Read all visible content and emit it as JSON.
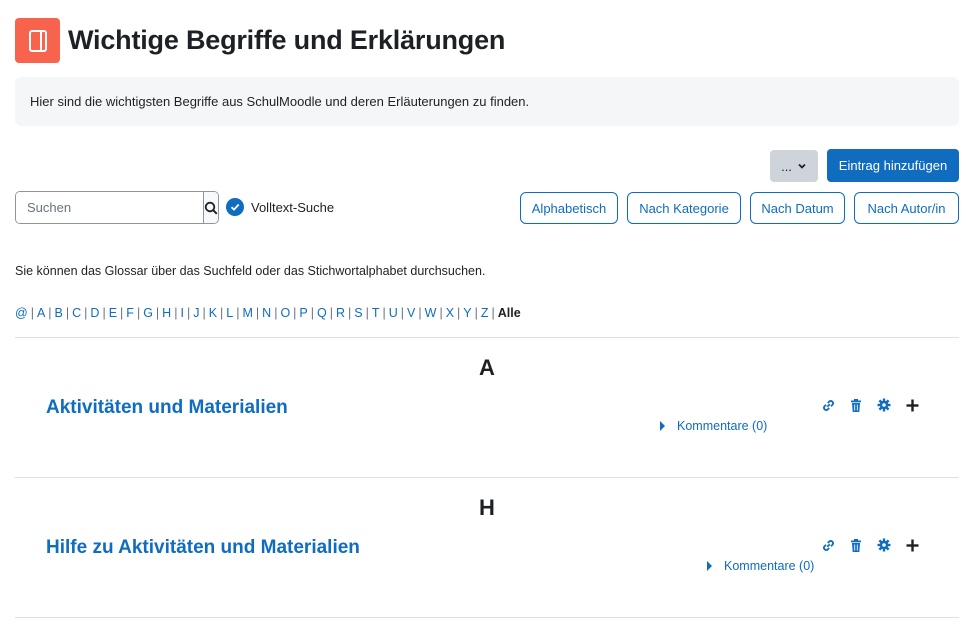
{
  "page": {
    "title": "Wichtige Begriffe und Erklärungen",
    "intro": "Hier sind die wichtigsten Begriffe aus SchulMoodle und deren Erläuterungen zu finden."
  },
  "toolbar": {
    "more_label": "...",
    "add_label": "Eintrag hinzufügen"
  },
  "search": {
    "placeholder": "Suchen",
    "value": "",
    "fulltext_label": "Volltext-Suche",
    "fulltext_checked": true
  },
  "view_tabs": [
    "Alphabetisch",
    "Nach Kategorie",
    "Nach Datum",
    "Nach Autor/in"
  ],
  "hint": "Sie können das Glossar über das Suchfeld oder das Stichwortalphabet durchsuchen.",
  "alphabet": [
    "@",
    "A",
    "B",
    "C",
    "D",
    "E",
    "F",
    "G",
    "H",
    "I",
    "J",
    "K",
    "L",
    "M",
    "N",
    "O",
    "P",
    "Q",
    "R",
    "S",
    "T",
    "U",
    "V",
    "W",
    "X",
    "Y",
    "Z"
  ],
  "alphabet_all": "Alle",
  "sections": [
    {
      "letter": "A",
      "entry": "Aktivitäten und Materialien",
      "comments": "Kommentare (0)"
    },
    {
      "letter": "H",
      "entry": "Hilfe zu Aktivitäten und Materialien",
      "comments": "Kommentare (0)"
    }
  ],
  "icons": {
    "module": "glossary-book-icon",
    "search": "search-icon",
    "check": "check-icon",
    "entry_actions": [
      "link-icon",
      "trash-icon",
      "gear-icon",
      "plus-icon"
    ]
  },
  "colors": {
    "accent": "#0f6cbf",
    "module_icon_bg": "#f7634d",
    "intro_bg": "#f5f6f8",
    "more_btn_bg": "#ced4da"
  }
}
